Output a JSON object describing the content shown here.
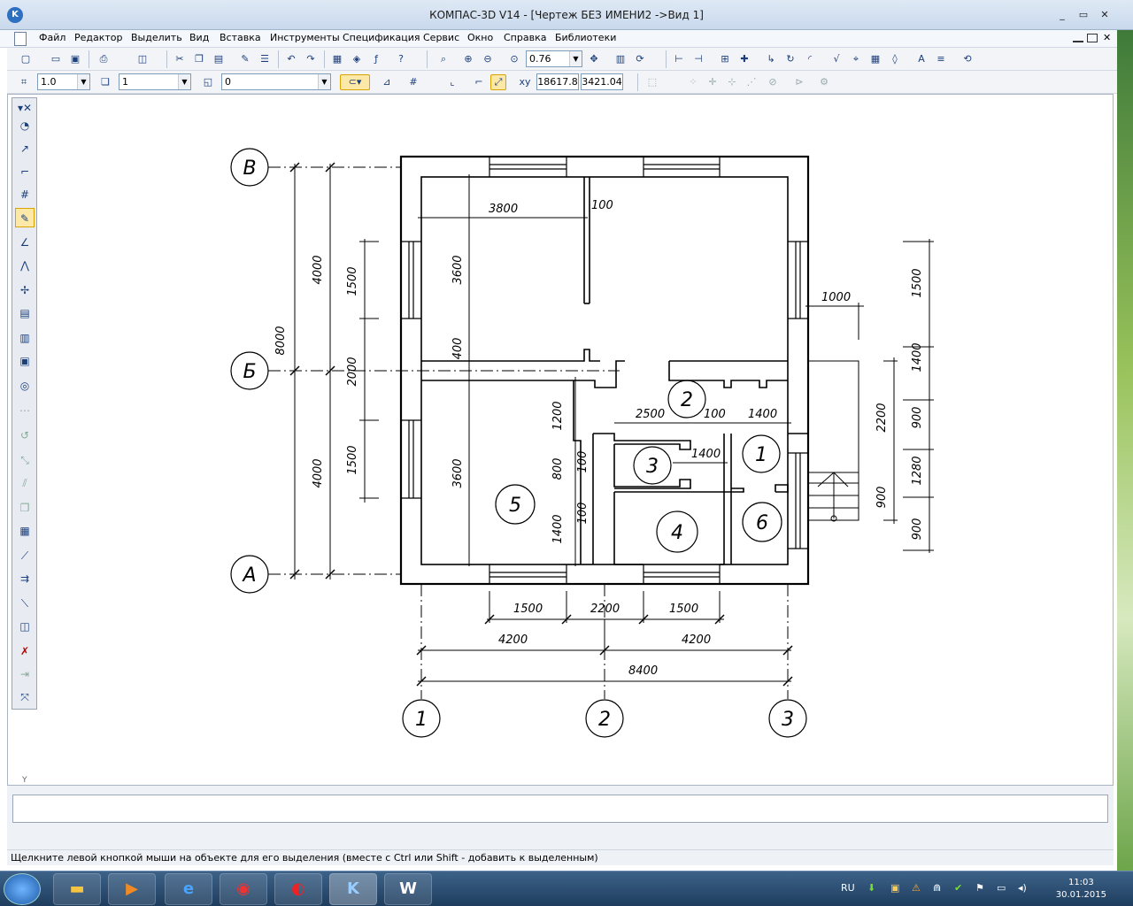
{
  "window": {
    "title": "КОМПАС-3D V14 - [Чертеж БЕЗ ИМЕНИ2 ->Вид 1]",
    "minimize_glyph": "_",
    "restore_glyph": "▭",
    "close_glyph": "✕"
  },
  "menu": {
    "items": [
      "Файл",
      "Редактор",
      "Выделить",
      "Вид",
      "Вставка",
      "Инструменты",
      "Спецификация",
      "Сервис",
      "Окно",
      "Справка",
      "Библиотеки"
    ]
  },
  "toolbar": {
    "zoom_value": "0.76"
  },
  "props": {
    "line_scale": "1.0",
    "layer": "1",
    "style": "0",
    "coord_x": "18617.8",
    "coord_y": "3421.04"
  },
  "drawing": {
    "axes_rows": [
      "В",
      "Б",
      "А"
    ],
    "axes_cols": [
      "1",
      "2",
      "3"
    ],
    "rooms": [
      "1",
      "2",
      "3",
      "4",
      "5",
      "6"
    ],
    "dims": {
      "d3800": "3800",
      "d100a": "100",
      "d3600a": "3600",
      "d400": "400",
      "d1000": "1000",
      "d4000a": "4000",
      "d4000b": "4000",
      "d8000": "8000",
      "d1500a": "1500",
      "d2000": "2000",
      "d1500b": "1500",
      "d3600b": "3600",
      "d1200": "1200",
      "d800": "800",
      "d100b": "100",
      "d100c": "100",
      "d1400a": "1400",
      "d2500": "2500",
      "d100d": "100",
      "d1400b": "1400",
      "d1400c": "1400",
      "d1500r": "1500",
      "d1400r": "1400",
      "d900a": "900",
      "d1280": "1280",
      "d900b": "900",
      "d2200r": "2200",
      "d900c": "900",
      "d1500c": "1500",
      "d2200": "2200",
      "d1500d": "1500",
      "d4200a": "4200",
      "d4200b": "4200",
      "d8400": "8400"
    }
  },
  "status": {
    "cmd_text": "",
    "hint": "Щелкните левой кнопкой мыши на объекте для его выделения (вместе с Ctrl или Shift - добавить к выделенным)",
    "y_label": "Y"
  },
  "taskbar": {
    "lang": "RU",
    "time": "11:03",
    "date": "30.01.2015"
  }
}
